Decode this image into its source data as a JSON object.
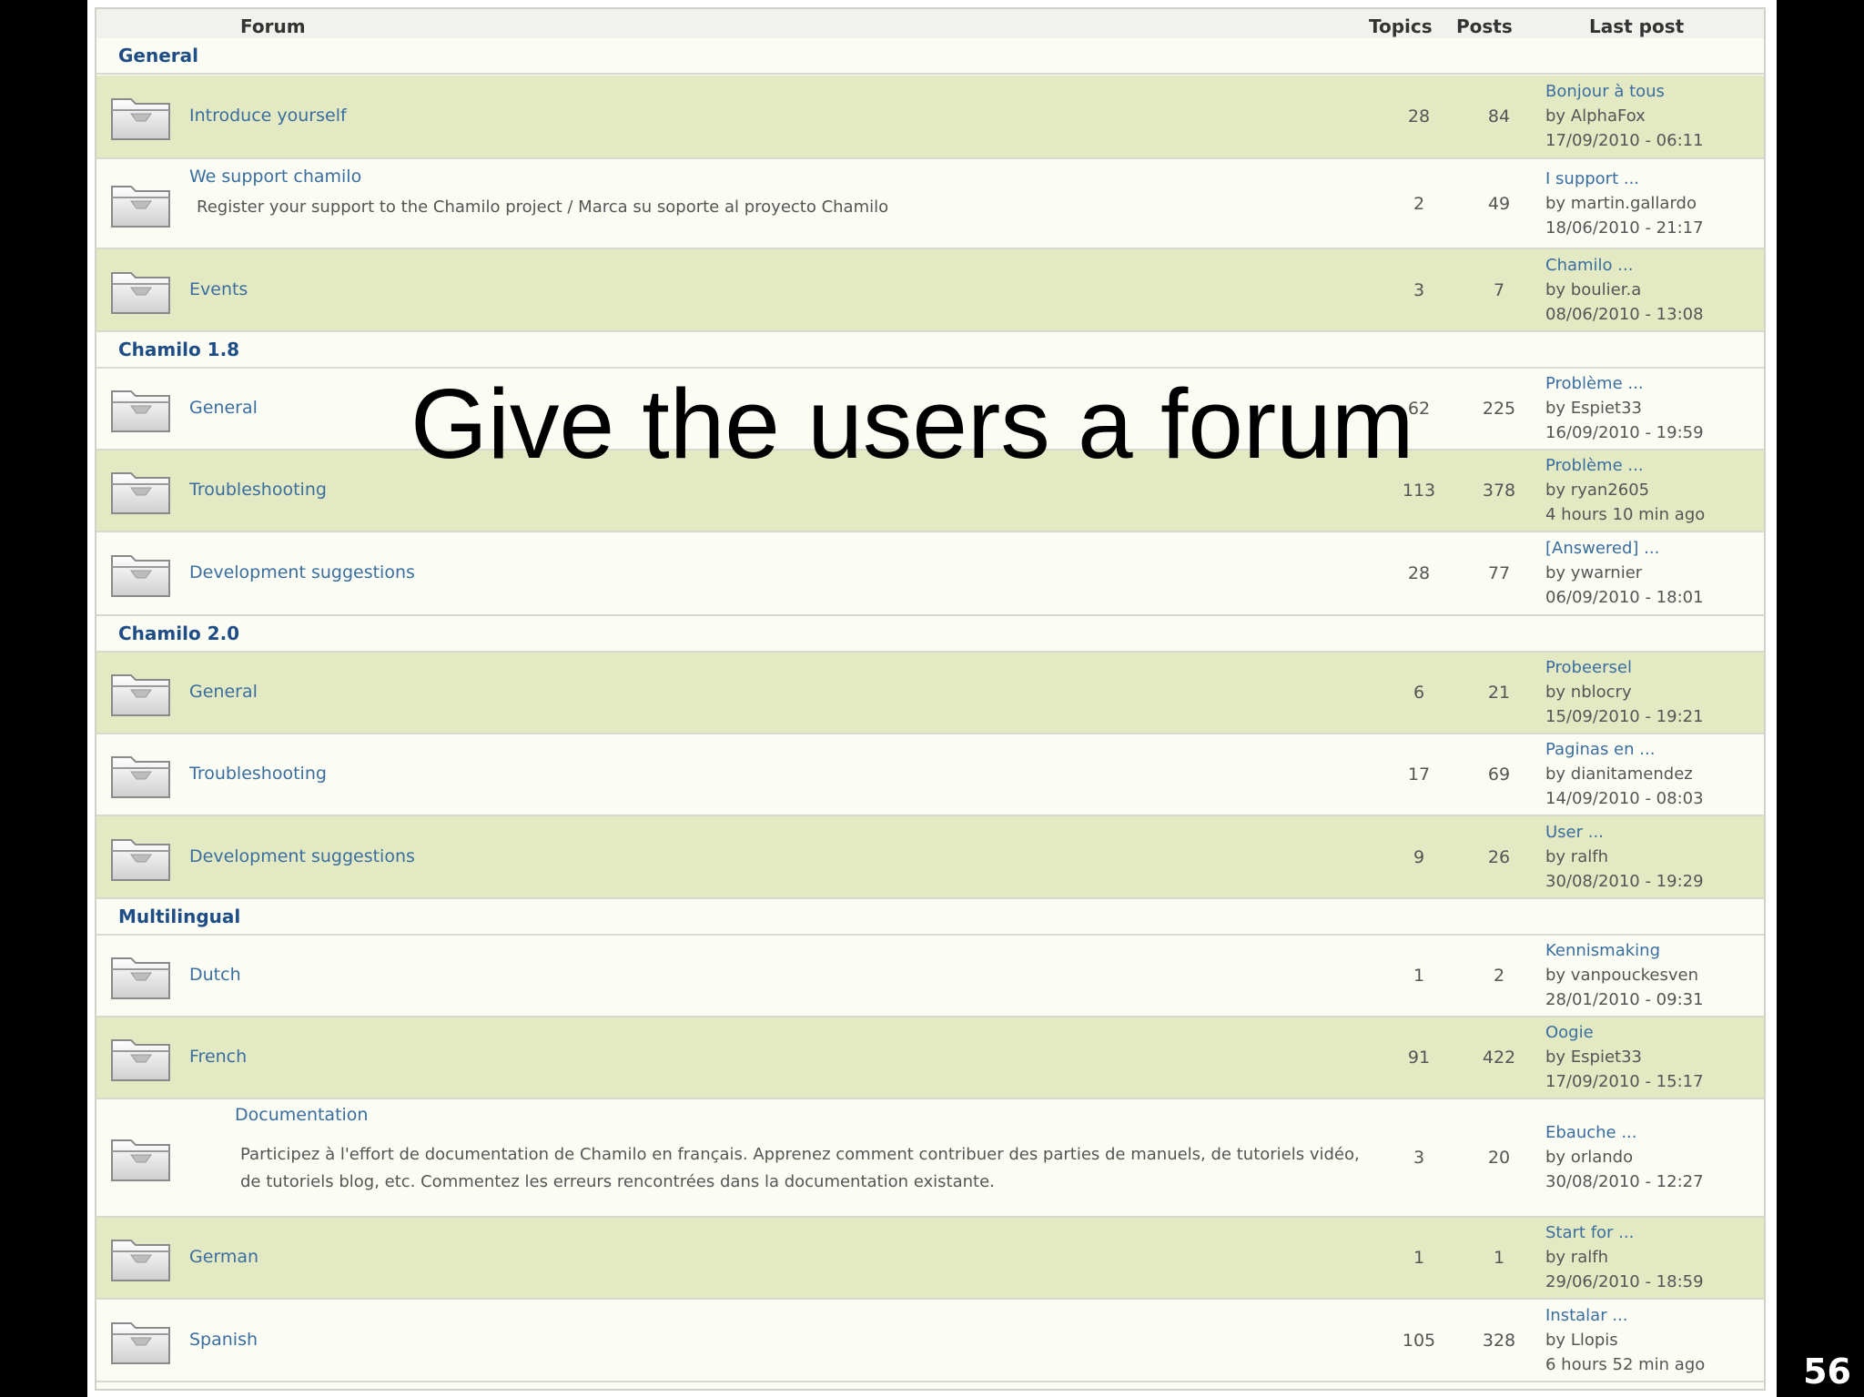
{
  "slide": {
    "title": "Give the users a forum",
    "number": "56"
  },
  "columns": {
    "forum": "Forum",
    "topics": "Topics",
    "posts": "Posts",
    "last_post": "Last post"
  },
  "icons": {
    "folder": "folder-icon"
  },
  "colors": {
    "row_even": "#e3e9c3",
    "row_odd": "#fbfcf3",
    "link": "#3a6ea0",
    "category": "#1f4d86"
  },
  "categories": [
    {
      "name": "General",
      "forums": [
        {
          "name": "Introduce yourself",
          "desc": "",
          "topics": "28",
          "posts": "84",
          "last_title": "Bonjour à tous",
          "last_by": "by AlphaFox",
          "last_date": "17/09/2010 - 06:11"
        },
        {
          "name": "We support chamilo",
          "desc": "Register your support to the Chamilo project / Marca su soporte al proyecto Chamilo",
          "topics": "2",
          "posts": "49",
          "last_title": "I support ...",
          "last_by": "by martin.gallardo",
          "last_date": "18/06/2010 - 21:17"
        },
        {
          "name": "Events",
          "desc": "",
          "topics": "3",
          "posts": "7",
          "last_title": "Chamilo ...",
          "last_by": "by boulier.a",
          "last_date": "08/06/2010 - 13:08"
        }
      ]
    },
    {
      "name": "Chamilo 1.8",
      "forums": [
        {
          "name": "General",
          "desc": "",
          "topics": "62",
          "posts": "225",
          "last_title": "Problème ...",
          "last_by": "by Espiet33",
          "last_date": "16/09/2010 - 19:59"
        },
        {
          "name": "Troubleshooting",
          "desc": "",
          "topics": "113",
          "posts": "378",
          "last_title": "Problème ...",
          "last_by": "by ryan2605",
          "last_date": "4 hours 10 min ago"
        },
        {
          "name": "Development suggestions",
          "desc": "",
          "topics": "28",
          "posts": "77",
          "last_title": "[Answered] ...",
          "last_by": "by ywarnier",
          "last_date": "06/09/2010 - 18:01"
        }
      ]
    },
    {
      "name": "Chamilo 2.0",
      "forums": [
        {
          "name": "General",
          "desc": "",
          "topics": "6",
          "posts": "21",
          "last_title": "Probeersel",
          "last_by": "by nblocry",
          "last_date": "15/09/2010 - 19:21"
        },
        {
          "name": "Troubleshooting",
          "desc": "",
          "topics": "17",
          "posts": "69",
          "last_title": "Paginas en ...",
          "last_by": "by dianitamendez",
          "last_date": "14/09/2010 - 08:03"
        },
        {
          "name": "Development suggestions",
          "desc": "",
          "topics": "9",
          "posts": "26",
          "last_title": "User ...",
          "last_by": "by ralfh",
          "last_date": "30/08/2010 - 19:29"
        }
      ]
    },
    {
      "name": "Multilingual",
      "forums": [
        {
          "name": "Dutch",
          "desc": "",
          "topics": "1",
          "posts": "2",
          "last_title": "Kennismaking",
          "last_by": "by vanpouckesven",
          "last_date": "28/01/2010 - 09:31"
        },
        {
          "name": "French",
          "desc": "",
          "topics": "91",
          "posts": "422",
          "last_title": "Oogie",
          "last_by": "by Espiet33",
          "last_date": "17/09/2010 - 15:17"
        },
        {
          "name": "Documentation",
          "desc": "Participez à l'effort de documentation de Chamilo en français. Apprenez comment contribuer des parties de manuels, de tutoriels vidéo, de tutoriels blog, etc. Commentez les erreurs rencontrées dans la documentation existante.",
          "topics": "3",
          "posts": "20",
          "last_title": "Ebauche ...",
          "last_by": "by orlando",
          "last_date": "30/08/2010 - 12:27",
          "subforum": true
        },
        {
          "name": "German",
          "desc": "",
          "topics": "1",
          "posts": "1",
          "last_title": "Start for ...",
          "last_by": "by ralfh",
          "last_date": "29/06/2010 - 18:59"
        },
        {
          "name": "Spanish",
          "desc": "",
          "topics": "105",
          "posts": "328",
          "last_title": "Instalar ...",
          "last_by": "by Llopis",
          "last_date": "6 hours 52 min ago"
        }
      ]
    }
  ]
}
